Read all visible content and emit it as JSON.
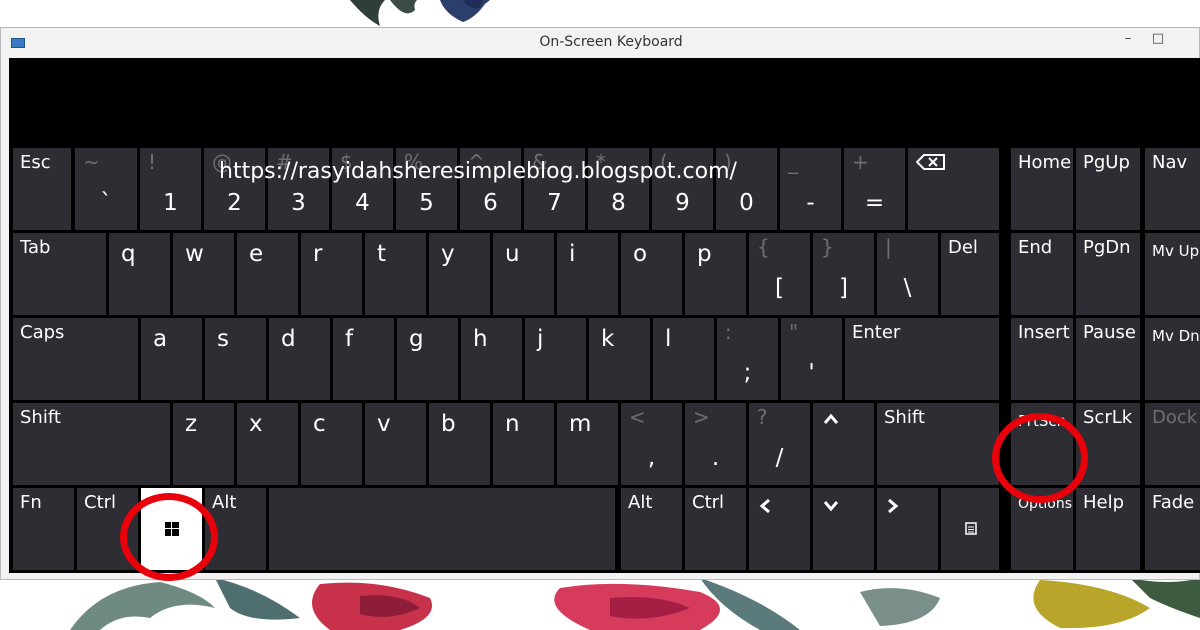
{
  "window": {
    "title": "On-Screen Keyboard",
    "minimize_glyph": "–",
    "maximize_glyph": "□"
  },
  "watermark_url": "https://rasyidahsheresimpleblog.blogspot.com/",
  "keys": {
    "esc": "Esc",
    "tilde": {
      "top": "~",
      "bottom": "`"
    },
    "n1": {
      "top": "!",
      "bottom": "1"
    },
    "n2": {
      "top": "@",
      "bottom": "2"
    },
    "n3": {
      "top": "#",
      "bottom": "3"
    },
    "n4": {
      "top": "$",
      "bottom": "4"
    },
    "n5": {
      "top": "%",
      "bottom": "5"
    },
    "n6": {
      "top": "^",
      "bottom": "6"
    },
    "n7": {
      "top": "&",
      "bottom": "7"
    },
    "n8": {
      "top": "*",
      "bottom": "8"
    },
    "n9": {
      "top": "(",
      "bottom": "9"
    },
    "n0": {
      "top": ")",
      "bottom": "0"
    },
    "minus": {
      "top": "_",
      "bottom": "-"
    },
    "equals": {
      "top": "+",
      "bottom": "="
    },
    "home": "Home",
    "pgup": "PgUp",
    "nav": "Nav",
    "tab": "Tab",
    "q": "q",
    "w": "w",
    "e": "e",
    "r": "r",
    "t": "t",
    "y": "y",
    "u": "u",
    "i": "i",
    "o": "o",
    "p": "p",
    "lbracket": {
      "top": "{",
      "bottom": "["
    },
    "rbracket": {
      "top": "}",
      "bottom": "]"
    },
    "backslash": {
      "top": "|",
      "bottom": "\\"
    },
    "del": "Del",
    "end": "End",
    "pgdn": "PgDn",
    "mvup": "Mv Up",
    "caps": "Caps",
    "a": "a",
    "s": "s",
    "d": "d",
    "f": "f",
    "g": "g",
    "h": "h",
    "j": "j",
    "k": "k",
    "l": "l",
    "semicolon": {
      "top": ":",
      "bottom": ";"
    },
    "quote": {
      "top": "\"",
      "bottom": "'"
    },
    "enter": "Enter",
    "insert": "Insert",
    "pause": "Pause",
    "mvdn": "Mv Dn",
    "shift_l": "Shift",
    "z": "z",
    "x": "x",
    "c": "c",
    "v": "v",
    "b": "b",
    "n": "n",
    "m": "m",
    "comma": {
      "top": "<",
      "bottom": ","
    },
    "period": {
      "top": ">",
      "bottom": "."
    },
    "slash": {
      "top": "?",
      "bottom": "/"
    },
    "shift_r": "Shift",
    "prtscn": "PrtScn",
    "scrlk": "ScrLk",
    "dock": "Dock",
    "fn": "Fn",
    "ctrl_l": "Ctrl",
    "alt_l": "Alt",
    "alt_r": "Alt",
    "ctrl_r": "Ctrl",
    "options": "Options",
    "help": "Help",
    "fade": "Fade"
  },
  "highlights": [
    "windows-key",
    "prtscn-key"
  ],
  "colors": {
    "key_bg": "#2d2d33",
    "highlight_ring": "#e8000a",
    "dim_text": "#6e6e74"
  }
}
